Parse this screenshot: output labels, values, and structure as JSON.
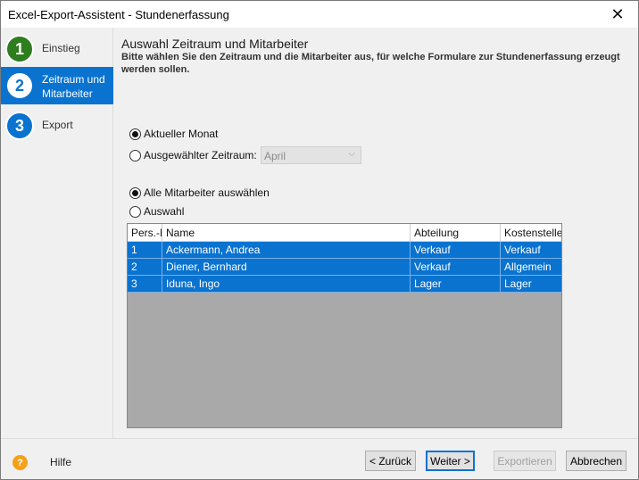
{
  "window": {
    "title": "Excel-Export-Assistent - Stundenerfassung",
    "close_glyph": "✕"
  },
  "steps": [
    {
      "number": "1",
      "label": "Einstieg",
      "color": "#2e7d1f"
    },
    {
      "number": "2",
      "label_line1": "Zeitraum und",
      "label_line2": "Mitarbeiter",
      "active": true
    },
    {
      "number": "3",
      "label": "Export",
      "color": "#0a73d0"
    }
  ],
  "main": {
    "heading": "Auswahl Zeitraum und Mitarbeiter",
    "description": "Bitte wählen Sie den Zeitraum und die Mitarbeiter aus, für welche Formulare zur Stundenerfassung erzeugt werden sollen.",
    "period": {
      "current_month_label": "Aktueller Monat",
      "current_month_selected": true,
      "selected_period_label": "Ausgewählter Zeitraum:",
      "selected_period_selected": false,
      "month_value": "April"
    },
    "employees": {
      "all_label": "Alle Mitarbeiter auswählen",
      "all_selected": true,
      "selection_label": "Auswahl",
      "selection_selected": false
    },
    "table": {
      "columns": [
        "Pers.-Nr.",
        "Name",
        "Abteilung",
        "Kostenstelle"
      ],
      "rows": [
        [
          "1",
          "Ackermann, Andrea",
          "Verkauf",
          "Verkauf"
        ],
        [
          "2",
          "Diener, Bernhard",
          "Verkauf",
          "Allgemein"
        ],
        [
          "3",
          "Iduna, Ingo",
          "Lager",
          "Lager"
        ]
      ]
    }
  },
  "footer": {
    "help_glyph": "?",
    "help_label": "Hilfe",
    "back_label": "< Zurück",
    "next_label": "Weiter >",
    "export_label": "Exportieren",
    "cancel_label": "Abbrechen"
  },
  "colors": {
    "accent": "#0a73d0",
    "grid_background": "#a9a9a9",
    "help_icon": "#f4a11a"
  }
}
